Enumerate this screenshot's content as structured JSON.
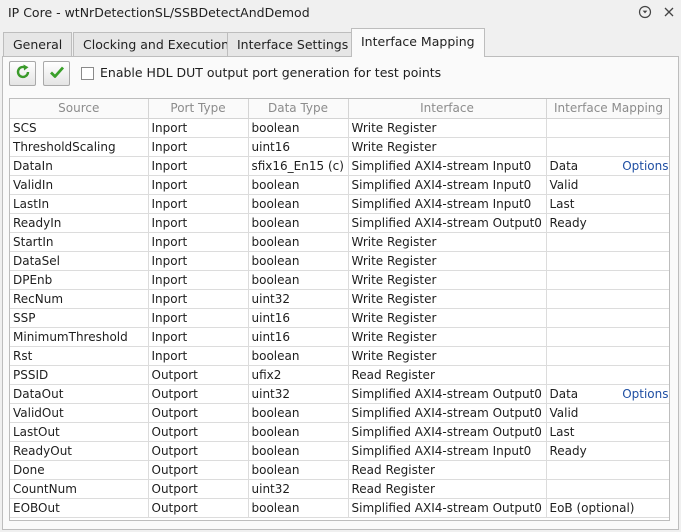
{
  "window": {
    "title": "IP Core - wtNrDetectionSL/SSBDetectAndDemod"
  },
  "tabs": [
    {
      "label": "General"
    },
    {
      "label": "Clocking and Execution"
    },
    {
      "label": "Interface Settings"
    },
    {
      "label": "Interface Mapping"
    }
  ],
  "active_tab": "Interface Mapping",
  "toolbar": {
    "checkbox_label": "Enable HDL DUT output port generation for test points",
    "checkbox_checked": false
  },
  "table": {
    "headers": [
      "Source",
      "Port Type",
      "Data Type",
      "Interface",
      "Interface Mapping"
    ],
    "rows": [
      {
        "source": "SCS",
        "port_type": "Inport",
        "data_type": "boolean",
        "interface": "Write Register",
        "mapping": "",
        "options": ""
      },
      {
        "source": "ThresholdScaling",
        "port_type": "Inport",
        "data_type": "uint16",
        "interface": "Write Register",
        "mapping": "",
        "options": ""
      },
      {
        "source": "DataIn",
        "port_type": "Inport",
        "data_type": "sfix16_En15 (c)",
        "interface": "Simplified AXI4-stream Input0",
        "mapping": "Data",
        "options": "Options"
      },
      {
        "source": "ValidIn",
        "port_type": "Inport",
        "data_type": "boolean",
        "interface": "Simplified AXI4-stream Input0",
        "mapping": "Valid",
        "options": ""
      },
      {
        "source": "LastIn",
        "port_type": "Inport",
        "data_type": "boolean",
        "interface": "Simplified AXI4-stream Input0",
        "mapping": "Last",
        "options": ""
      },
      {
        "source": "ReadyIn",
        "port_type": "Inport",
        "data_type": "boolean",
        "interface": "Simplified AXI4-stream Output0",
        "mapping": "Ready",
        "options": ""
      },
      {
        "source": "StartIn",
        "port_type": "Inport",
        "data_type": "boolean",
        "interface": "Write Register",
        "mapping": "",
        "options": ""
      },
      {
        "source": "DataSel",
        "port_type": "Inport",
        "data_type": "boolean",
        "interface": "Write Register",
        "mapping": "",
        "options": ""
      },
      {
        "source": "DPEnb",
        "port_type": "Inport",
        "data_type": "boolean",
        "interface": "Write Register",
        "mapping": "",
        "options": ""
      },
      {
        "source": "RecNum",
        "port_type": "Inport",
        "data_type": "uint32",
        "interface": "Write Register",
        "mapping": "",
        "options": ""
      },
      {
        "source": "SSP",
        "port_type": "Inport",
        "data_type": "uint16",
        "interface": "Write Register",
        "mapping": "",
        "options": ""
      },
      {
        "source": "MinimumThreshold",
        "port_type": "Inport",
        "data_type": "uint16",
        "interface": "Write Register",
        "mapping": "",
        "options": ""
      },
      {
        "source": "Rst",
        "port_type": "Inport",
        "data_type": "boolean",
        "interface": "Write Register",
        "mapping": "",
        "options": ""
      },
      {
        "source": "PSSID",
        "port_type": "Outport",
        "data_type": "ufix2",
        "interface": "Read Register",
        "mapping": "",
        "options": ""
      },
      {
        "source": "DataOut",
        "port_type": "Outport",
        "data_type": "uint32",
        "interface": "Simplified AXI4-stream Output0",
        "mapping": "Data",
        "options": "Options"
      },
      {
        "source": "ValidOut",
        "port_type": "Outport",
        "data_type": "boolean",
        "interface": "Simplified AXI4-stream Output0",
        "mapping": "Valid",
        "options": ""
      },
      {
        "source": "LastOut",
        "port_type": "Outport",
        "data_type": "boolean",
        "interface": "Simplified AXI4-stream Output0",
        "mapping": "Last",
        "options": ""
      },
      {
        "source": "ReadyOut",
        "port_type": "Outport",
        "data_type": "boolean",
        "interface": "Simplified AXI4-stream Input0",
        "mapping": "Ready",
        "options": ""
      },
      {
        "source": "Done",
        "port_type": "Outport",
        "data_type": "boolean",
        "interface": "Read Register",
        "mapping": "",
        "options": ""
      },
      {
        "source": "CountNum",
        "port_type": "Outport",
        "data_type": "uint32",
        "interface": "Read Register",
        "mapping": "",
        "options": ""
      },
      {
        "source": "EOBOut",
        "port_type": "Outport",
        "data_type": "boolean",
        "interface": "Simplified AXI4-stream Output0",
        "mapping": "EoB (optional)",
        "options": ""
      }
    ]
  },
  "icons": {
    "titlebar": [
      "help-circle-icon",
      "close-icon"
    ],
    "toolbar": [
      "refresh-icon",
      "checkmark-icon"
    ]
  },
  "colors": {
    "link": "#1f4fa3",
    "refresh_green": "#3a9a2a",
    "check_green": "#3aa02a"
  }
}
